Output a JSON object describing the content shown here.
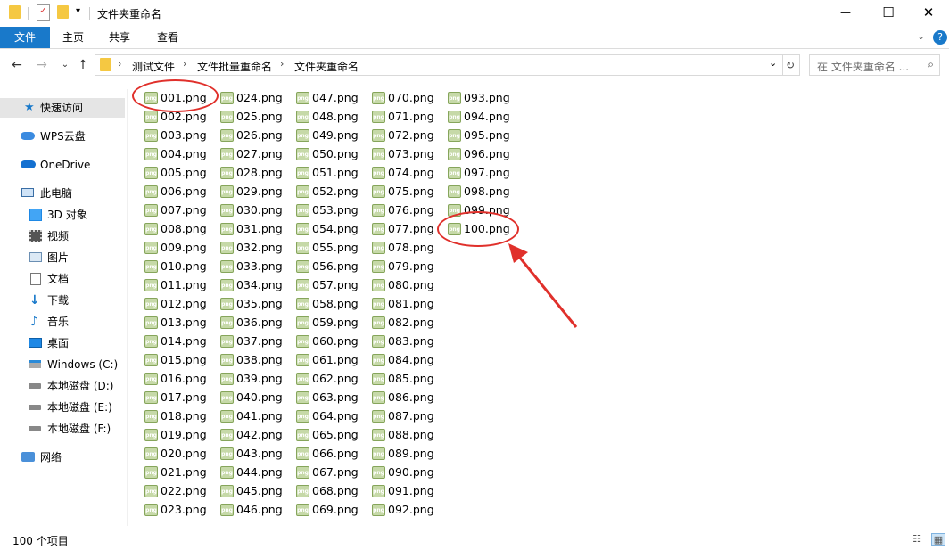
{
  "window": {
    "title": "文件夹重命名",
    "minimize_glyph": "—",
    "maximize_glyph": "☐",
    "close_glyph": "✕"
  },
  "ribbon": {
    "tabs": [
      "文件",
      "主页",
      "共享",
      "查看"
    ]
  },
  "address": {
    "crumbs": [
      "测试文件",
      "文件批量重命名",
      "文件夹重命名"
    ],
    "separator": "›"
  },
  "search": {
    "placeholder": "在 文件夹重命名 ..."
  },
  "sidebar": {
    "items": [
      {
        "label": "快速访问",
        "icon": "star-icon"
      },
      {
        "label": "WPS云盘",
        "icon": "cloud-icon"
      },
      {
        "label": "OneDrive",
        "icon": "onedrive-icon"
      },
      {
        "label": "此电脑",
        "icon": "computer-icon"
      },
      {
        "label": "3D 对象",
        "icon": "cube-icon"
      },
      {
        "label": "视频",
        "icon": "video-icon"
      },
      {
        "label": "图片",
        "icon": "picture-icon"
      },
      {
        "label": "文档",
        "icon": "document-icon"
      },
      {
        "label": "下载",
        "icon": "download-icon"
      },
      {
        "label": "音乐",
        "icon": "music-icon"
      },
      {
        "label": "桌面",
        "icon": "desktop-icon"
      },
      {
        "label": "Windows (C:)",
        "icon": "drive-windows-icon"
      },
      {
        "label": "本地磁盘 (D:)",
        "icon": "drive-icon"
      },
      {
        "label": "本地磁盘 (E:)",
        "icon": "drive-icon"
      },
      {
        "label": "本地磁盘 (F:)",
        "icon": "drive-icon"
      },
      {
        "label": "网络",
        "icon": "network-icon"
      }
    ]
  },
  "files": {
    "icon_text": "png",
    "names": [
      "001.png",
      "002.png",
      "003.png",
      "004.png",
      "005.png",
      "006.png",
      "007.png",
      "008.png",
      "009.png",
      "010.png",
      "011.png",
      "012.png",
      "013.png",
      "014.png",
      "015.png",
      "016.png",
      "017.png",
      "018.png",
      "019.png",
      "020.png",
      "021.png",
      "022.png",
      "023.png",
      "024.png",
      "025.png",
      "026.png",
      "027.png",
      "028.png",
      "029.png",
      "030.png",
      "031.png",
      "032.png",
      "033.png",
      "034.png",
      "035.png",
      "036.png",
      "037.png",
      "038.png",
      "039.png",
      "040.png",
      "041.png",
      "042.png",
      "043.png",
      "044.png",
      "045.png",
      "046.png",
      "047.png",
      "048.png",
      "049.png",
      "050.png",
      "051.png",
      "052.png",
      "053.png",
      "054.png",
      "055.png",
      "056.png",
      "057.png",
      "058.png",
      "059.png",
      "060.png",
      "061.png",
      "062.png",
      "063.png",
      "064.png",
      "065.png",
      "066.png",
      "067.png",
      "068.png",
      "069.png",
      "070.png",
      "071.png",
      "072.png",
      "073.png",
      "074.png",
      "075.png",
      "076.png",
      "077.png",
      "078.png",
      "079.png",
      "080.png",
      "081.png",
      "082.png",
      "083.png",
      "084.png",
      "085.png",
      "086.png",
      "087.png",
      "088.png",
      "089.png",
      "090.png",
      "091.png",
      "092.png",
      "093.png",
      "094.png",
      "095.png",
      "096.png",
      "097.png",
      "098.png",
      "099.png",
      "100.png"
    ]
  },
  "status": {
    "item_count": "100 个项目"
  },
  "colors": {
    "accent": "#1979ca",
    "annotation": "#e0302b"
  }
}
